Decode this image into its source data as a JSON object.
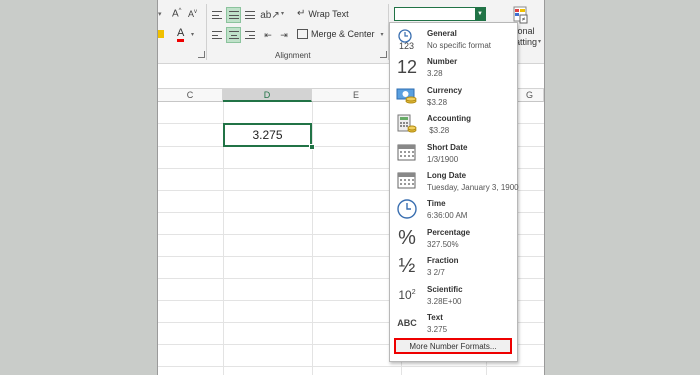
{
  "ribbon": {
    "wrap_text": "Wrap Text",
    "merge_center": "Merge & Center",
    "alignment_label": "Alignment",
    "cond_format_partial_1": "itional",
    "cond_format_partial_2": "atting",
    "font_grow": "A",
    "font_shrink": "A",
    "font_color_letter": "A"
  },
  "columns": [
    "C",
    "D",
    "E",
    "G"
  ],
  "selected_cell": {
    "value": "3.275"
  },
  "number_format_menu": {
    "items": [
      {
        "name": "General",
        "sample": "No specific format",
        "icon": "general-123-icon"
      },
      {
        "name": "Number",
        "sample": "3.28",
        "icon": "number-12-icon"
      },
      {
        "name": "Currency",
        "sample": "$3.28",
        "icon": "currency-icon"
      },
      {
        "name": "Accounting",
        "sample": " $3.28",
        "icon": "accounting-icon"
      },
      {
        "name": "Short Date",
        "sample": "1/3/1900",
        "icon": "calendar-icon"
      },
      {
        "name": "Long Date",
        "sample": "Tuesday, January 3, 1900",
        "icon": "calendar-long-icon"
      },
      {
        "name": "Time",
        "sample": "6:36:00 AM",
        "icon": "clock-icon"
      },
      {
        "name": "Percentage",
        "sample": "327.50%",
        "icon": "percent-icon"
      },
      {
        "name": "Fraction",
        "sample": "3 2/7",
        "icon": "fraction-icon"
      },
      {
        "name": "Scientific",
        "sample": "3.28E+00",
        "icon": "scientific-icon"
      },
      {
        "name": "Text",
        "sample": "3.275",
        "icon": "abc-text-icon"
      }
    ],
    "more_label": "More Number Formats...",
    "glyphs": {
      "number": "12",
      "percent": "%",
      "fraction": "½",
      "scientific_base": "10",
      "scientific_exp": "2",
      "text": "ABC",
      "general": "123"
    }
  },
  "colors": {
    "accent": "#217346",
    "highlight": "#e00000"
  }
}
